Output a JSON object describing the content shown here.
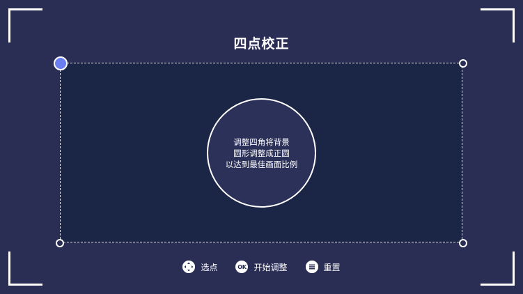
{
  "screen": {
    "title": "四点校正"
  },
  "instructions": {
    "line1": "调整四角将背景",
    "line2": "圆形调整成正圆",
    "line3": "以达到最佳画面比例"
  },
  "footer": {
    "select_label": "选点",
    "start_label": "开始调整",
    "start_icon_text": "OK",
    "reset_label": "重置"
  },
  "colors": {
    "background": "#2a2e55",
    "frame_fill": "#1b2647",
    "active_handle": "#6b7ef0"
  }
}
